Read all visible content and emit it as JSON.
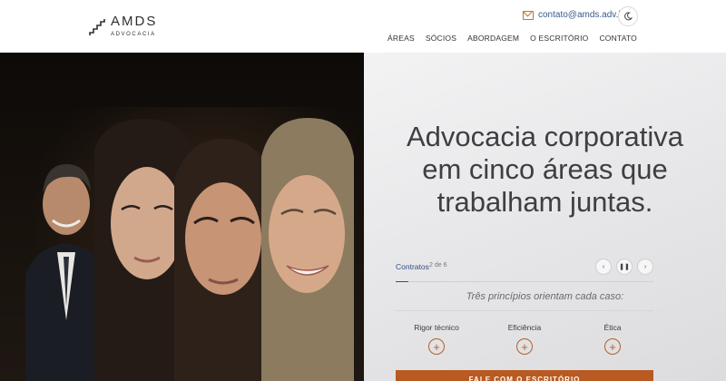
{
  "brand": {
    "name": "AMDS",
    "subtitle": "ADVOCACIA"
  },
  "header": {
    "email": "contato@amds.adv.br",
    "nav": [
      "ÁREAS",
      "SÓCIOS",
      "ABORDAGEM",
      "O ESCRITÓRIO",
      "CONTATO"
    ]
  },
  "hero": {
    "headline_lines": [
      "Advocacia corporativa",
      "em cinco áreas que",
      "trabalham juntas."
    ],
    "slider": {
      "label": "Contratos",
      "counter": "2 de 6",
      "progress": 0.05
    },
    "principles_text": "Três princípios orientam cada caso:",
    "pillars": [
      "Rigor técnico",
      "Eficiência",
      "Ética"
    ],
    "cta_label": "FALE COM O ESCRITÓRIO"
  },
  "colors": {
    "accent": "#b85a22",
    "link": "#2f4f7f"
  }
}
